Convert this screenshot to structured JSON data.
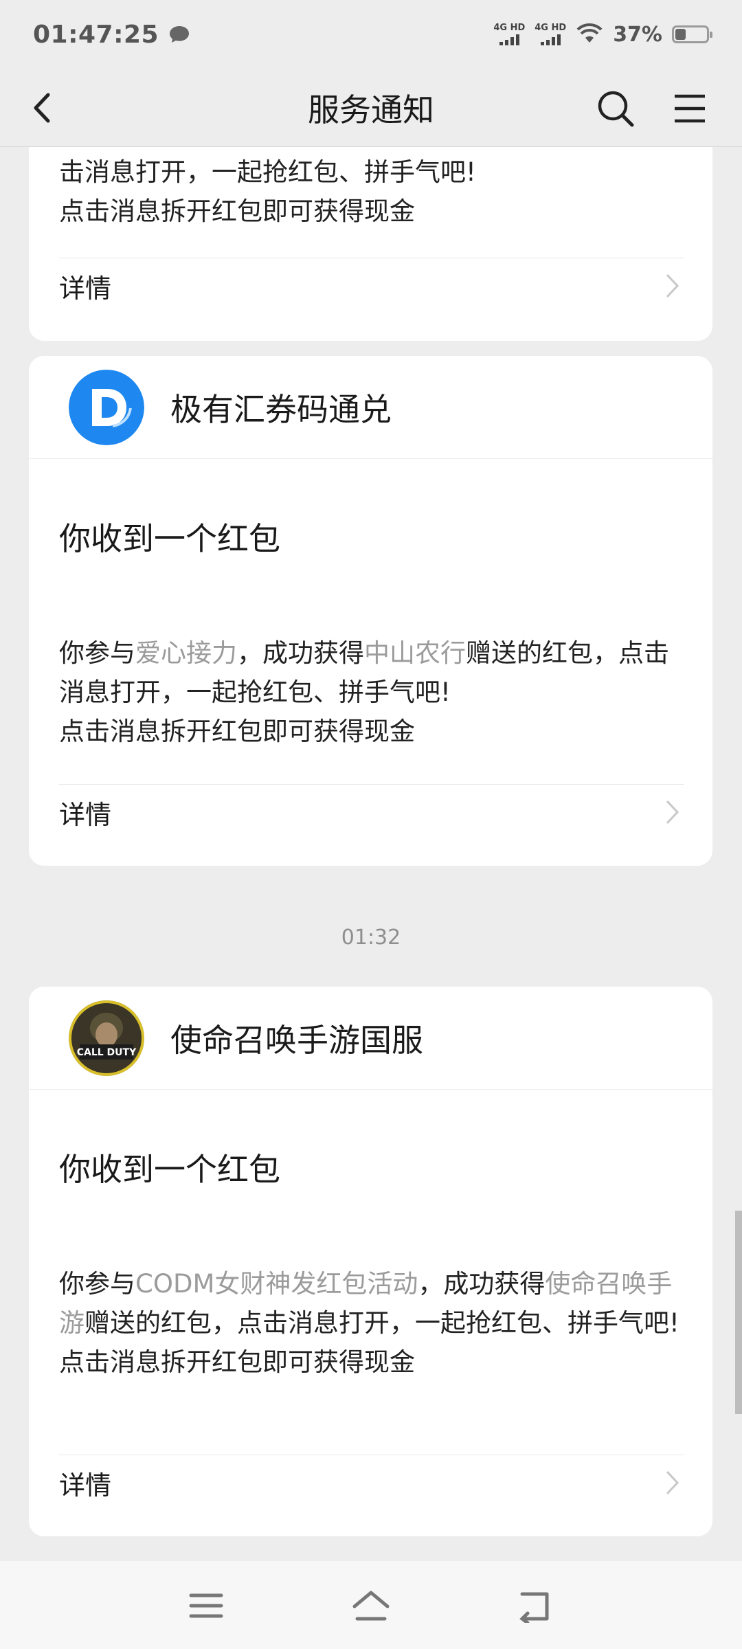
{
  "status_bar": {
    "time": "01:47:25",
    "network1": "4G HD",
    "network2": "4G HD",
    "battery": "37%"
  },
  "nav": {
    "title": "服务通知"
  },
  "cards": [
    {
      "body_line1": "击消息打开，一起抢红包、拼手气吧!",
      "body_line2": "点击消息拆开红包即可获得现金",
      "detail": "详情"
    },
    {
      "account": "极有汇券码通兑",
      "title": "你收到一个红包",
      "body_prefix": "你参与",
      "activity": "爱心接力",
      "body_mid": "，成功获得",
      "sender": "中山农行",
      "body_suffix": "赠送的红包，点击消息打开，一起抢红包、拼手气吧!",
      "body_line2": "点击消息拆开红包即可获得现金",
      "detail": "详情"
    },
    {
      "account": "使命召唤手游国服",
      "title": "你收到一个红包",
      "body_prefix": "你参与",
      "activity": "CODM女财神发红包活动",
      "body_mid": "，成功获得",
      "sender": "使命召唤手游",
      "body_suffix": "赠送的红包，点击消息打开，一起抢红包、拼手气吧!",
      "body_line2": "点击消息拆开红包即可获得现金",
      "detail": "详情"
    }
  ],
  "timestamp": "01:32",
  "avatar_text": "CALL DUTY",
  "colors": {
    "background": "#ededed",
    "card": "#ffffff",
    "highlight_text": "#9b9b9b",
    "avatar_blue": "#1e88f0"
  }
}
